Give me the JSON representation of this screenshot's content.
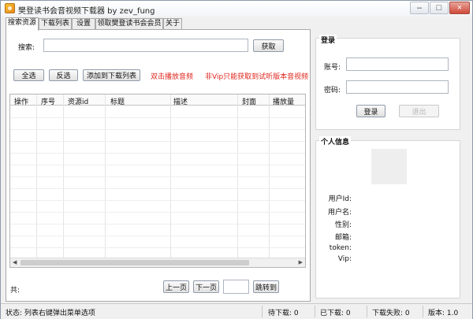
{
  "window": {
    "title": "樊登读书会音视频下载器 by zev_fung",
    "minimize": "–",
    "maximize": "□",
    "close": "×"
  },
  "tabs": [
    {
      "label": "搜索资源",
      "active": true
    },
    {
      "label": "下载列表",
      "active": false
    },
    {
      "label": "设置",
      "active": false
    },
    {
      "label": "领取樊登读书会会员",
      "active": false
    },
    {
      "label": "关于",
      "active": false
    }
  ],
  "search": {
    "label": "搜索:",
    "value": "",
    "fetch_button": "获取"
  },
  "toolbar": {
    "select_all": "全选",
    "invert_select": "反选",
    "add_to_download": "添加到下载列表",
    "hint_double_click": "双击播放音频",
    "hint_vip": "非Vip只能获取到试听版本音视频"
  },
  "table": {
    "columns": [
      "操作",
      "序号",
      "资源id",
      "标题",
      "描述",
      "封面",
      "播放量"
    ],
    "rows": []
  },
  "footer": {
    "total_label": "共:",
    "prev_page": "上一页",
    "next_page": "下一页",
    "page_input": "",
    "jump_button": "跳转到"
  },
  "login": {
    "title": "登录",
    "account_label": "账号:",
    "account_value": "",
    "password_label": "密码:",
    "password_value": "",
    "login_button": "登录",
    "logout_button": "退出"
  },
  "profile": {
    "title": "个人信息",
    "fields": [
      {
        "label": "用户Id:",
        "value": ""
      },
      {
        "label": "用户名:",
        "value": ""
      },
      {
        "label": "性别:",
        "value": ""
      },
      {
        "label": "邮箱:",
        "value": ""
      },
      {
        "label": "token:",
        "value": ""
      },
      {
        "label": "Vip:",
        "value": ""
      }
    ]
  },
  "statusbar": {
    "status": "状态: 列表右键弹出菜单选项",
    "pending": "待下载: 0",
    "downloaded": "已下载: 0",
    "failed": "下载失败: 0",
    "version": "版本: 1.0"
  },
  "colors": {
    "hint_red": "#e0261d",
    "window_bg": "#f0f0f0",
    "close_button": "#cf4a3a"
  },
  "icons": {
    "app": "app-icon"
  }
}
